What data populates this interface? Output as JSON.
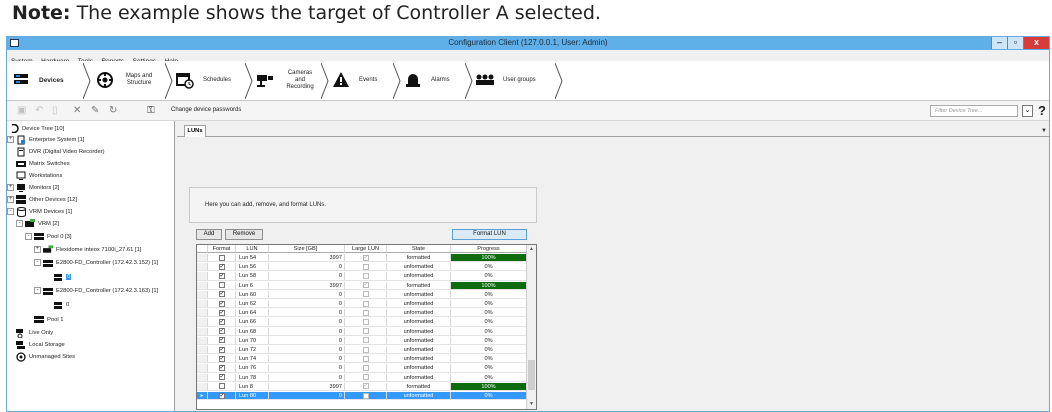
{
  "note": {
    "bold": "Note:",
    "text": " The example shows the target of Controller A selected."
  },
  "window": {
    "title": "Configuration Client (127.0.0.1, User: Admin)",
    "minimize": "–",
    "maximize": "▫",
    "close": "x"
  },
  "menu": [
    "System",
    "Hardware",
    "Tools",
    "Reports",
    "Settings",
    "Help"
  ],
  "nav": [
    {
      "label": "Devices",
      "icon": "devices-icon"
    },
    {
      "label": "Maps and Structure",
      "icon": "maps-icon"
    },
    {
      "label": "Schedules",
      "icon": "schedules-icon"
    },
    {
      "label": "Cameras and Recording",
      "icon": "cameras-icon"
    },
    {
      "label": "Events",
      "icon": "events-icon"
    },
    {
      "label": "Alarms",
      "icon": "alarms-icon"
    },
    {
      "label": "User groups",
      "icon": "usergroups-icon"
    }
  ],
  "toolbar": {
    "change_passwords": "Change device passwords",
    "filter_placeholder": "Filter Device Tree...",
    "help": "?"
  },
  "tree": [
    {
      "label": "Device Tree [10]"
    },
    {
      "label": "Enterprise System [1]"
    },
    {
      "label": "DVR (Digital Video Recorder)"
    },
    {
      "label": "Matrix Switches"
    },
    {
      "label": "Workstations"
    },
    {
      "label": "Monitors [2]"
    },
    {
      "label": "Other Devices [12]"
    },
    {
      "label": "VRM Devices [1]"
    },
    {
      "label": "VRM [2]"
    },
    {
      "label": "Pool 0 [3]"
    },
    {
      "label": "Flexidome inteox 7100i_27.61 [1]"
    },
    {
      "label": "E2800-FD_Controller (172.42.3.152) [1]"
    },
    {
      "label": "0"
    },
    {
      "label": "E2800-FD_Controller (172.42.3.163) [1]"
    },
    {
      "label": "0"
    },
    {
      "label": "Pool 1"
    },
    {
      "label": "Live Only"
    },
    {
      "label": "Local Storage"
    },
    {
      "label": "Unmanaged Sites"
    }
  ],
  "main": {
    "tab": "LUNs",
    "info": "Here you can add, remove, and format LUNs.",
    "add": "Add",
    "remove": "Remove",
    "format_lun": "Format LUN",
    "columns": [
      "Format",
      "LUN",
      "Size [GB]",
      "Large LUN",
      "State",
      "Progress"
    ],
    "rows": [
      {
        "format": false,
        "lun": "Lun 54",
        "size": "3997",
        "large": true,
        "state": "formatted",
        "progress": "100%",
        "pct": 100
      },
      {
        "format": true,
        "lun": "Lun 56",
        "size": "0",
        "large": false,
        "state": "unformatted",
        "progress": "0%",
        "pct": 0
      },
      {
        "format": true,
        "lun": "Lun 58",
        "size": "0",
        "large": false,
        "state": "unformatted",
        "progress": "0%",
        "pct": 0
      },
      {
        "format": false,
        "lun": "Lun 6",
        "size": "3997",
        "large": true,
        "state": "formatted",
        "progress": "100%",
        "pct": 100
      },
      {
        "format": true,
        "lun": "Lun 60",
        "size": "0",
        "large": false,
        "state": "unformatted",
        "progress": "0%",
        "pct": 0
      },
      {
        "format": true,
        "lun": "Lun 62",
        "size": "0",
        "large": false,
        "state": "unformatted",
        "progress": "0%",
        "pct": 0
      },
      {
        "format": true,
        "lun": "Lun 64",
        "size": "0",
        "large": false,
        "state": "unformatted",
        "progress": "0%",
        "pct": 0
      },
      {
        "format": true,
        "lun": "Lun 66",
        "size": "0",
        "large": false,
        "state": "unformatted",
        "progress": "0%",
        "pct": 0
      },
      {
        "format": true,
        "lun": "Lun 68",
        "size": "0",
        "large": false,
        "state": "unformatted",
        "progress": "0%",
        "pct": 0
      },
      {
        "format": true,
        "lun": "Lun 70",
        "size": "0",
        "large": false,
        "state": "unformatted",
        "progress": "0%",
        "pct": 0
      },
      {
        "format": true,
        "lun": "Lun 72",
        "size": "0",
        "large": false,
        "state": "unformatted",
        "progress": "0%",
        "pct": 0
      },
      {
        "format": true,
        "lun": "Lun 74",
        "size": "0",
        "large": false,
        "state": "unformatted",
        "progress": "0%",
        "pct": 0
      },
      {
        "format": true,
        "lun": "Lun 76",
        "size": "0",
        "large": false,
        "state": "unformatted",
        "progress": "0%",
        "pct": 0
      },
      {
        "format": true,
        "lun": "Lun 78",
        "size": "0",
        "large": false,
        "state": "unformatted",
        "progress": "0%",
        "pct": 0
      },
      {
        "format": false,
        "lun": "Lun 8",
        "size": "3997",
        "large": true,
        "state": "formatted",
        "progress": "100%",
        "pct": 100
      },
      {
        "format": true,
        "lun": "Lun 80",
        "size": "0",
        "large": false,
        "state": "unformatted",
        "progress": "0%",
        "pct": 0,
        "selected": true
      }
    ]
  },
  "colors": {
    "titlebar": "#5fb0e8",
    "selection": "#3399ff",
    "progress_fill": "#0e6b0e",
    "close_button": "#d73a3a"
  }
}
